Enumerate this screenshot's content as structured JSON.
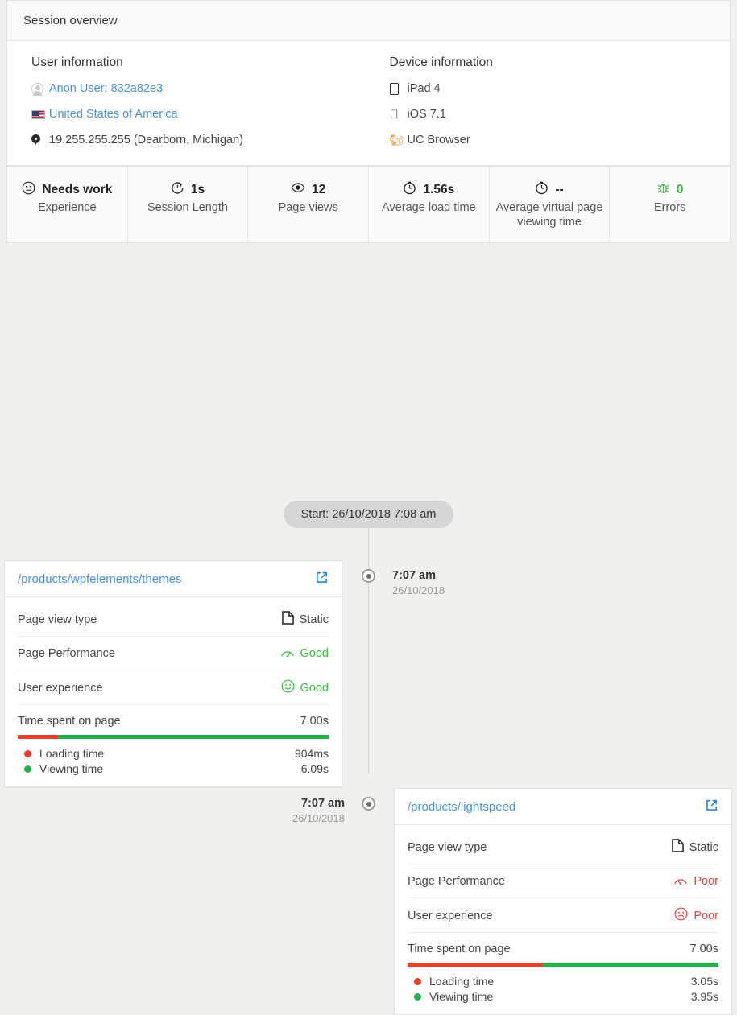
{
  "header": {
    "title": "Session overview"
  },
  "user_information": {
    "title": "User information",
    "rows": [
      {
        "icon": "avatar-icon",
        "text": "Anon User: 832a82e3",
        "link": true
      },
      {
        "icon": "flag-usa-icon",
        "text": "United States of America",
        "link": true
      },
      {
        "icon": "map-pin-icon",
        "text": "19.255.255.255 (Dearborn, Michigan)",
        "link": false
      }
    ]
  },
  "device_information": {
    "title": "Device information",
    "rows": [
      {
        "icon": "tablet-icon",
        "text": "iPad 4"
      },
      {
        "icon": "apple-icon",
        "text": "iOS 7.1"
      },
      {
        "icon": "uc-browser-icon",
        "text": "UC Browser"
      }
    ]
  },
  "metrics": [
    {
      "icon": "neutral-face-icon",
      "value": "Needs work",
      "label": "Experience",
      "color": "#222222"
    },
    {
      "icon": "stopwatch-icon",
      "value": "1s",
      "label": "Session Length",
      "color": "#222222"
    },
    {
      "icon": "eye-icon",
      "value": "12",
      "label": "Page views",
      "color": "#222222"
    },
    {
      "icon": "clock-icon",
      "value": "1.56s",
      "label": "Average load time",
      "color": "#222222"
    },
    {
      "icon": "clock-icon",
      "value": "--",
      "label": "Average virtual page viewing time",
      "color": "#222222"
    },
    {
      "icon": "bug-icon",
      "value": "0",
      "label": "Errors",
      "color": "#3bbf3b"
    }
  ],
  "timeline": {
    "start_badge": "Start: 26/10/2018 7:08 am",
    "events": [
      {
        "side": "left",
        "time": "7:07 am",
        "date": "26/10/2018",
        "url": "/products/wpfelements/themes",
        "open_icon": "external-link-icon",
        "rows": [
          {
            "key": "Page view type",
            "value": "Static",
            "icon": "document-icon",
            "tone": "plain"
          },
          {
            "key": "Page Performance",
            "value": "Good",
            "icon": "gauge-icon",
            "tone": "good"
          },
          {
            "key": "User experience",
            "value": "Good",
            "icon": "smiley-icon",
            "tone": "good"
          }
        ],
        "time_spent_label": "Time spent on page",
        "time_spent_value": "7.00s",
        "loading_label": "Loading time",
        "loading_value": "904ms",
        "viewing_label": "Viewing time",
        "viewing_value": "6.09s",
        "loading_pct": 12.9
      },
      {
        "side": "right",
        "time": "7:07 am",
        "date": "26/10/2018",
        "url": "/products/lightspeed",
        "open_icon": "external-link-icon",
        "rows": [
          {
            "key": "Page view type",
            "value": "Static",
            "icon": "document-icon",
            "tone": "plain"
          },
          {
            "key": "Page Performance",
            "value": "Poor",
            "icon": "gauge-icon",
            "tone": "poor"
          },
          {
            "key": "User experience",
            "value": "Poor",
            "icon": "frowny-icon",
            "tone": "poor"
          }
        ],
        "time_spent_label": "Time spent on page",
        "time_spent_value": "7.00s",
        "loading_label": "Loading time",
        "loading_value": "3.05s",
        "viewing_label": "Viewing time",
        "viewing_value": "3.95s",
        "loading_pct": 43.6
      }
    ]
  },
  "colors": {
    "link": "#4a90d9",
    "good": "#3bbf3b",
    "poor": "#d9453c",
    "bar_red": "#e8402a",
    "bar_green": "#22b24c",
    "page_bg": "#f0f0ef"
  }
}
